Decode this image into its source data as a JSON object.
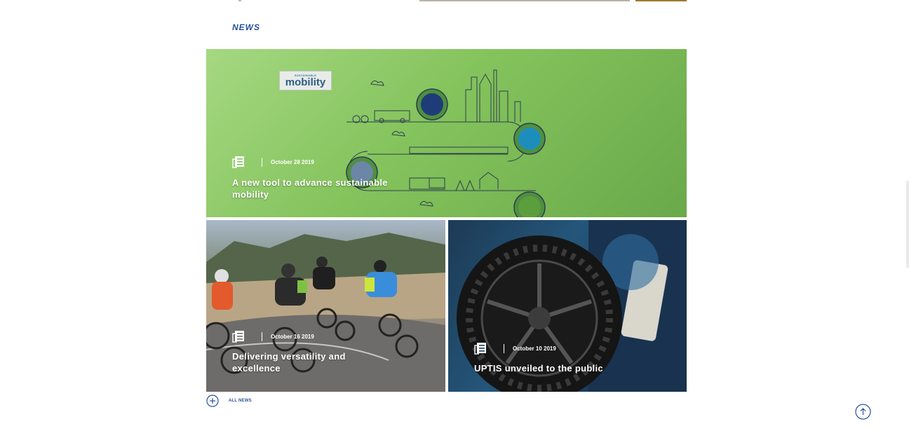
{
  "section": {
    "title": "NEWS"
  },
  "news": [
    {
      "date": "October 28 2019",
      "title_line1": "A new tool to advance sustainable",
      "title_line2": "mobility",
      "logo_small": "SUSTAINABLE",
      "logo_word": "mobility",
      "icon": "document-icon"
    },
    {
      "date": "October 16 2019",
      "title_line1": "Delivering versatility and",
      "title_line2": "excellence",
      "icon": "document-icon"
    },
    {
      "date": "October 10 2019",
      "title_line1": "UPTIS unveiled to the public",
      "icon": "document-icon"
    }
  ],
  "all_news": {
    "label": "ALL NEWS",
    "icon": "plus-circle-icon"
  },
  "scroll_top": {
    "icon": "arrow-up-circle-icon"
  },
  "colors": {
    "brand_blue": "#27509b",
    "card_green": "#84c35c"
  }
}
